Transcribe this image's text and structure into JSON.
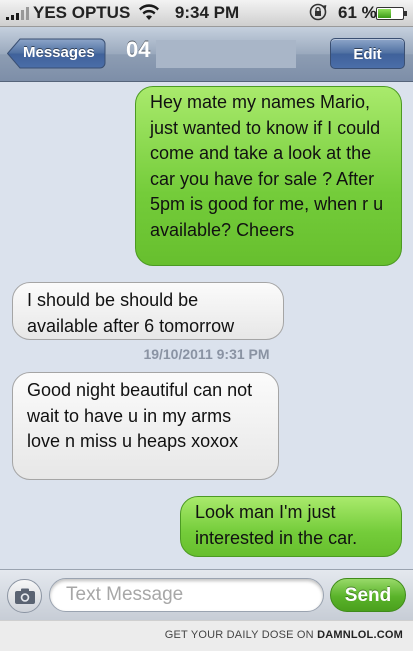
{
  "status_bar": {
    "carrier": "YES OPTUS",
    "time": "9:34 PM",
    "battery_percent": "61 %",
    "battery_level": 0.61
  },
  "nav": {
    "back_label": "Messages",
    "title": "04",
    "edit_label": "Edit"
  },
  "messages": [
    {
      "direction": "outgoing",
      "text": "Hey mate my names Mario, just wanted to know if I could come and take a look at the car you have for sale ? After 5pm is good for me, when r u available? Cheers"
    },
    {
      "direction": "incoming",
      "text": "I should be should be available after 6 tomorrow"
    },
    {
      "direction": "timestamp",
      "text": "19/10/2011 9:31 PM"
    },
    {
      "direction": "incoming",
      "text": "Good night beautiful can not wait to have u in my arms love n miss u heaps xoxox"
    },
    {
      "direction": "outgoing",
      "text": "Look man I'm just interested in the car."
    }
  ],
  "input_bar": {
    "placeholder": "Text Message",
    "value": "",
    "send_label": "Send"
  },
  "footer": {
    "prefix": "GET YOUR DAILY DOSE ON ",
    "brand": "DAMNLOL.COM"
  },
  "colors": {
    "outgoing_bubble": "#74cc3a",
    "incoming_bubble": "#ececec",
    "thread_background": "#dbe2ed",
    "send_button": "#5ab32a"
  }
}
